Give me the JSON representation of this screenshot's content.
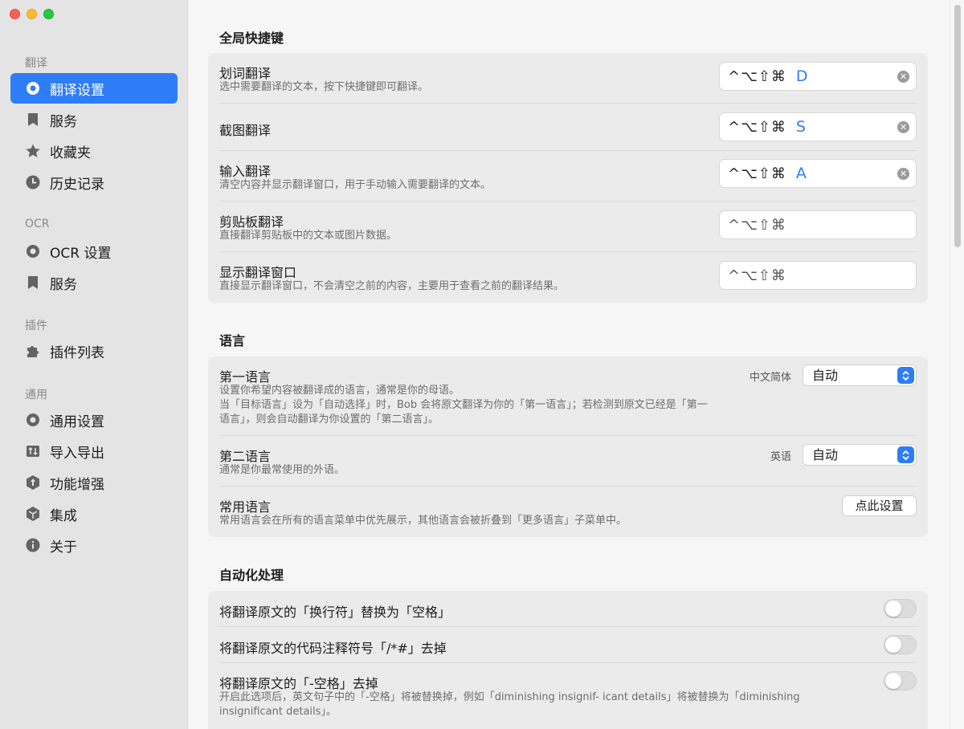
{
  "sidebar": {
    "sections": [
      {
        "label": "翻译",
        "items": [
          {
            "label": "翻译设置",
            "icon": "gear-icon",
            "active": true
          },
          {
            "label": "服务",
            "icon": "bookmark-icon"
          },
          {
            "label": "收藏夹",
            "icon": "star-icon"
          },
          {
            "label": "历史记录",
            "icon": "clock-icon"
          }
        ]
      },
      {
        "label": "OCR",
        "items": [
          {
            "label": "OCR 设置",
            "icon": "gear-icon"
          },
          {
            "label": "服务",
            "icon": "bookmark-icon"
          }
        ]
      },
      {
        "label": "插件",
        "items": [
          {
            "label": "插件列表",
            "icon": "puzzle-icon"
          }
        ]
      },
      {
        "label": "通用",
        "items": [
          {
            "label": "通用设置",
            "icon": "gear-icon"
          },
          {
            "label": "导入导出",
            "icon": "import-export-icon"
          },
          {
            "label": "功能增强",
            "icon": "enhance-icon"
          },
          {
            "label": "集成",
            "icon": "integration-icon"
          },
          {
            "label": "关于",
            "icon": "info-icon"
          }
        ]
      }
    ]
  },
  "shortcuts": {
    "heading": "全局快捷键",
    "modifier_symbols": "^⌥⇧⌘",
    "rows": [
      {
        "title": "划词翻译",
        "desc": "选中需要翻译的文本，按下快捷键即可翻译。",
        "key": "D",
        "set": true
      },
      {
        "title": "截图翻译",
        "desc": "",
        "key": "S",
        "set": true
      },
      {
        "title": "输入翻译",
        "desc": "清空内容并显示翻译窗口，用于手动输入需要翻译的文本。",
        "key": "A",
        "set": true
      },
      {
        "title": "剪贴板翻译",
        "desc": "直接翻译剪贴板中的文本或图片数据。",
        "key": "",
        "set": false
      },
      {
        "title": "显示翻译窗口",
        "desc": "直接显示翻译窗口，不会清空之前的内容，主要用于查看之前的翻译结果。",
        "key": "",
        "set": false
      }
    ]
  },
  "language": {
    "heading": "语言",
    "first": {
      "title": "第一语言",
      "desc_lines": [
        "设置你希望内容被翻译成的语言，通常是你的母语。",
        "当「目标语言」设为「自动选择」时，Bob 会将原文翻译为你的「第一语言」；若检测到原文已经是「第一",
        "语言」，则会自动翻译为你设置的「第二语言」。"
      ],
      "label": "中文简体",
      "value": "自动"
    },
    "second": {
      "title": "第二语言",
      "desc": "通常是你最常使用的外语。",
      "label": "英语",
      "value": "自动"
    },
    "common": {
      "title": "常用语言",
      "desc": "常用语言会在所有的语言菜单中优先展示，其他语言会被折叠到「更多语言」子菜单中。",
      "button": "点此设置"
    }
  },
  "automation": {
    "heading": "自动化处理",
    "rows": [
      {
        "title": "将翻译原文的「换行符」替换为「空格」",
        "enabled": false
      },
      {
        "title": "将翻译原文的代码注释符号「/*#」去掉",
        "enabled": false
      },
      {
        "title": "将翻译原文的「-空格」去掉",
        "desc_lines": [
          "开启此选项后，英文句子中的「-空格」将被替换掉，例如「diminishing insignif- icant details」将被替换为「diminishing",
          "insignificant details」。"
        ],
        "enabled": false
      }
    ]
  },
  "colors": {
    "accent": "#2f7df6"
  }
}
